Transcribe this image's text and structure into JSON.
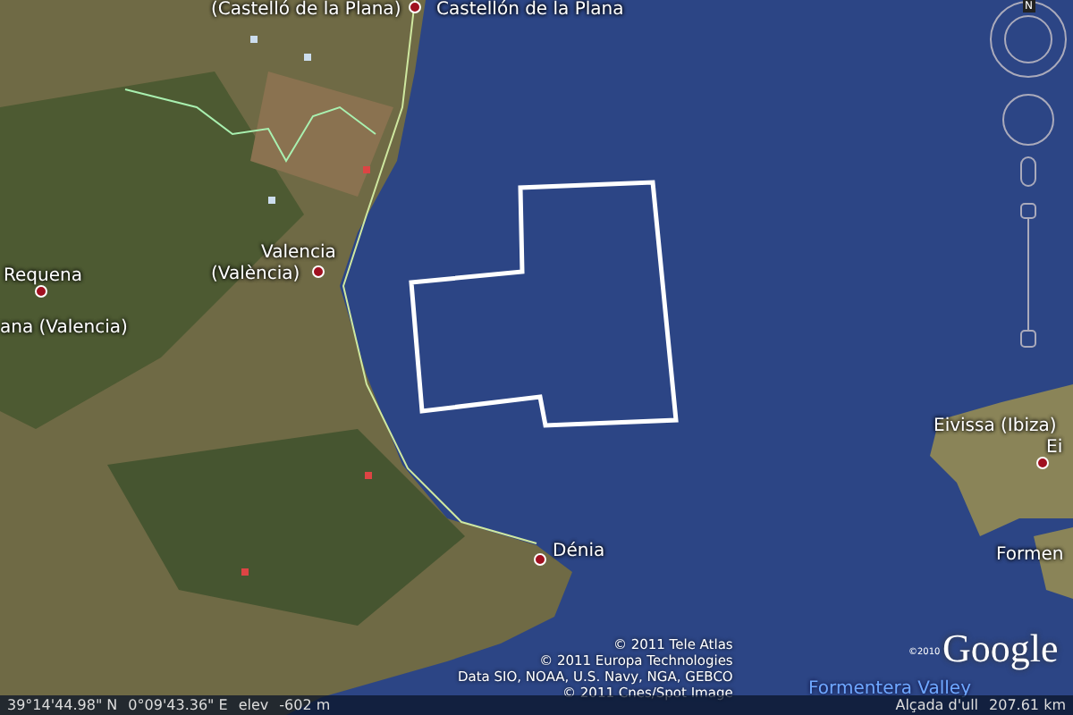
{
  "map": {
    "labels": [
      {
        "text": "(Castelló de la Plana)",
        "kind": "city"
      },
      {
        "text": "Castellón de la Plana",
        "kind": "city"
      },
      {
        "text": "Valencia",
        "kind": "city"
      },
      {
        "text": "(València)",
        "kind": "city"
      },
      {
        "text": "Requena",
        "kind": "city"
      },
      {
        "text": "ana (Valencia)",
        "kind": "city"
      },
      {
        "text": "Dénia",
        "kind": "city"
      },
      {
        "text": "Eivissa (Ibiza)",
        "kind": "city"
      },
      {
        "text": "Ei",
        "kind": "city"
      },
      {
        "text": "Formen",
        "kind": "city"
      },
      {
        "text": "Formentera Valley",
        "kind": "water"
      }
    ],
    "compass": {
      "north": "N"
    },
    "attribution": [
      "© 2011 Tele Atlas",
      "© 2011 Europa Technologies",
      "Data SIO, NOAA, U.S. Navy, NGA, GEBCO",
      "© 2011 Cnes/Spot Image"
    ],
    "logo": {
      "text": "Google",
      "copyright": "©2010"
    }
  },
  "status_bar": {
    "latitude": "39°14'44.98\" N",
    "longitude": "0°09'43.36\" E",
    "elevation_label": "elev",
    "elevation": "-602 m",
    "eye_altitude_label": "Alçada d'ull",
    "eye_altitude": "207.61 km"
  }
}
